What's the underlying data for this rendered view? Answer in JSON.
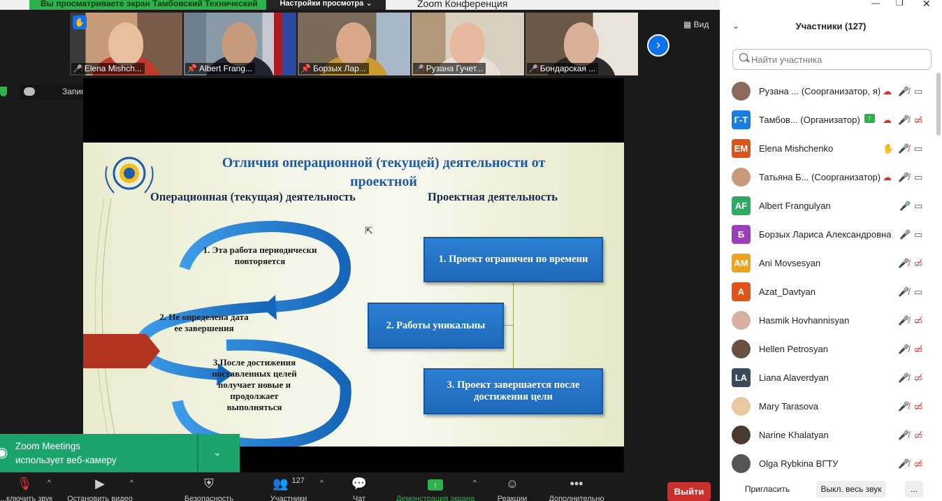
{
  "titlebar": {
    "share_banner": "Вы просматриваете экран Тамбовский Технический",
    "view_settings": "Настройки просмотра ⌄",
    "app_title": "Zoom Конференция"
  },
  "thumbnails": [
    {
      "name": "Elena Mishch...",
      "muted": true,
      "hand": true
    },
    {
      "name": "Albert Frang...",
      "pinned": true,
      "active": true
    },
    {
      "name": "Борзых Лар...",
      "pinned": true
    },
    {
      "name": "Рузана Гучет...",
      "muted": true
    },
    {
      "name": "Бондарская ...",
      "muted": true
    }
  ],
  "view_button": "Вид",
  "recording": {
    "label": "Запись...",
    "pause": "❚❚",
    "stop": "■"
  },
  "slide": {
    "title": "Отличия операционной (текущей) деятельности от проектной",
    "col_left": "Операционная (текущая)  деятельность",
    "col_right": "Проектная деятельность",
    "op_items": [
      "1. Эта работа периодически повторяется",
      "2. Не определена дата ее завершения",
      "3.После достижения поставленных целей получает новые и продолжает выполняться"
    ],
    "proj_items": [
      "1. Проект ограничен по времени",
      "2. Работы уникальны",
      "3. Проект завершается после достижения цели"
    ]
  },
  "toast": {
    "line1": "Zoom Meetings",
    "line2": "использует веб-камеру"
  },
  "toolbar": {
    "mute": "...ключить звук",
    "video": "Остановить видео",
    "security": "Безопасность",
    "participants": "Участники",
    "participants_count": "127",
    "chat": "Чат",
    "share": "Демонстрация экрана",
    "reactions": "Реакции",
    "more": "Дополнительно",
    "exit": "Выйти"
  },
  "panel": {
    "title": "Участники (127)",
    "search_placeholder": "Найти участника",
    "participants": [
      {
        "name": "Рузана ... (Соорганизатор, я)",
        "avatar": "",
        "color": "#8a6a5a",
        "photo": true,
        "rec": true,
        "mic": "off",
        "cam": "on"
      },
      {
        "name": "Тамбов... (Организатор)",
        "avatar": "Г-Т",
        "color": "#1a7de0",
        "photo": false,
        "share": true,
        "rec": true,
        "mic": "off",
        "cam": "off"
      },
      {
        "name": "Elena Mishchenko",
        "avatar": "EM",
        "color": "#e0531a",
        "photo": false,
        "hand": true,
        "mic": "off",
        "cam": "on"
      },
      {
        "name": "Татьяна Б... (Соорганизатор)",
        "avatar": "",
        "color": "#c99a7a",
        "photo": true,
        "rec": true,
        "mic": "off",
        "cam": "on"
      },
      {
        "name": "Albert Frangulyan",
        "avatar": "AF",
        "color": "#2bab62",
        "photo": false,
        "mic": "on",
        "cam": "on"
      },
      {
        "name": "Борзых Лариса Александровна",
        "avatar": "Б",
        "color": "#9a3fb8",
        "photo": false,
        "mic": "on",
        "cam": "on"
      },
      {
        "name": "Ani Movsesyan",
        "avatar": "AM",
        "color": "#f0a21a",
        "photo": false,
        "mic": "off",
        "cam": "off"
      },
      {
        "name": "Azat_Davtyan",
        "avatar": "A",
        "color": "#e0531a",
        "photo": false,
        "mic": "off",
        "cam": "on"
      },
      {
        "name": "Hasmik Hovhannisyan",
        "avatar": "",
        "color": "#d8b0a0",
        "photo": true,
        "mic": "off",
        "cam": "off"
      },
      {
        "name": "Hellen Petrosyan",
        "avatar": "",
        "color": "#6a5040",
        "photo": true,
        "mic": "off",
        "cam": "off"
      },
      {
        "name": "Liana Alaverdyan",
        "avatar": "LA",
        "color": "#3a4a5a",
        "photo": false,
        "mic": "off",
        "cam": "off"
      },
      {
        "name": "Mary Tarasova",
        "avatar": "",
        "color": "#e8c8a0",
        "photo": true,
        "mic": "off",
        "cam": "off"
      },
      {
        "name": "Narine Khalatyan",
        "avatar": "",
        "color": "#4a3a30",
        "photo": true,
        "mic": "off",
        "cam": "off"
      },
      {
        "name": "Olga Rybkina ВГТУ",
        "avatar": "",
        "color": "#555555",
        "photo": true,
        "mic": "off",
        "cam": "off"
      }
    ],
    "invite": "Пригласить",
    "mute_all": "Выкл. весь звук",
    "more": "..."
  }
}
